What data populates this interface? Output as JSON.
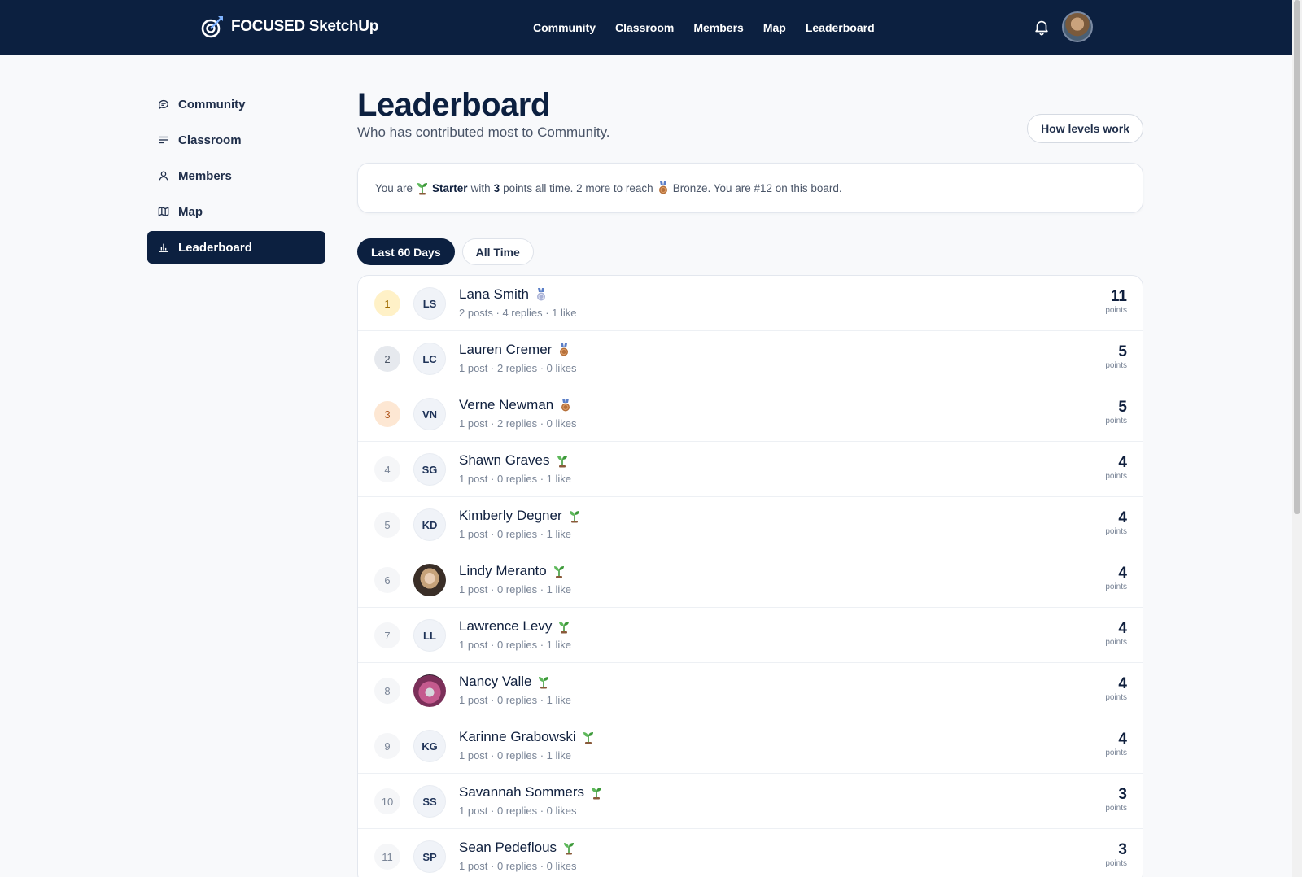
{
  "brand": {
    "name": "FOCUSED SketchUp",
    "icon": "target-arrow-logo-icon"
  },
  "topnav": [
    "Community",
    "Classroom",
    "Members",
    "Map",
    "Leaderboard"
  ],
  "sidebar": {
    "items": [
      {
        "label": "Community",
        "icon": "chat-bubble-icon",
        "active": false
      },
      {
        "label": "Classroom",
        "icon": "lines-icon",
        "active": false
      },
      {
        "label": "Members",
        "icon": "person-icon",
        "active": false
      },
      {
        "label": "Map",
        "icon": "map-icon",
        "active": false
      },
      {
        "label": "Leaderboard",
        "icon": "bar-chart-icon",
        "active": true
      }
    ]
  },
  "page": {
    "title": "Leaderboard",
    "subtitle": "Who has contributed most to Community.",
    "levels_button": "How levels work"
  },
  "status": {
    "you_are": "You are",
    "level": "Starter",
    "with": "with",
    "points": "3",
    "rest": "points all time. 2 more to reach",
    "next_level": "Bronze. You are #12 on this board."
  },
  "tabs": [
    {
      "label": "Last 60 Days",
      "active": true
    },
    {
      "label": "All Time",
      "active": false
    }
  ],
  "leaderboard": [
    {
      "rank": "1",
      "initials": "LS",
      "name": "Lana Smith",
      "badge": "silver",
      "meta": "2 posts · 4 replies · 1 like",
      "points": "11",
      "points_label": "points"
    },
    {
      "rank": "2",
      "initials": "LC",
      "name": "Lauren Cremer",
      "badge": "bronze",
      "meta": "1 post · 2 replies · 0 likes",
      "points": "5",
      "points_label": "points"
    },
    {
      "rank": "3",
      "initials": "VN",
      "name": "Verne Newman",
      "badge": "bronze",
      "meta": "1 post · 2 replies · 0 likes",
      "points": "5",
      "points_label": "points"
    },
    {
      "rank": "4",
      "initials": "SG",
      "name": "Shawn Graves",
      "badge": "starter",
      "meta": "1 post · 0 replies · 1 like",
      "points": "4",
      "points_label": "points"
    },
    {
      "rank": "5",
      "initials": "KD",
      "name": "Kimberly Degner",
      "badge": "starter",
      "meta": "1 post · 0 replies · 1 like",
      "points": "4",
      "points_label": "points"
    },
    {
      "rank": "6",
      "initials": "",
      "photo": "lindy",
      "name": "Lindy Meranto",
      "badge": "starter",
      "meta": "1 post · 0 replies · 1 like",
      "points": "4",
      "points_label": "points"
    },
    {
      "rank": "7",
      "initials": "LL",
      "name": "Lawrence Levy",
      "badge": "starter",
      "meta": "1 post · 0 replies · 1 like",
      "points": "4",
      "points_label": "points"
    },
    {
      "rank": "8",
      "initials": "",
      "photo": "nancy",
      "name": "Nancy Valle",
      "badge": "starter",
      "meta": "1 post · 0 replies · 1 like",
      "points": "4",
      "points_label": "points"
    },
    {
      "rank": "9",
      "initials": "KG",
      "name": "Karinne Grabowski",
      "badge": "starter",
      "meta": "1 post · 0 replies · 1 like",
      "points": "4",
      "points_label": "points"
    },
    {
      "rank": "10",
      "initials": "SS",
      "name": "Savannah Sommers",
      "badge": "starter",
      "meta": "1 post · 0 replies · 0 likes",
      "points": "3",
      "points_label": "points"
    },
    {
      "rank": "11",
      "initials": "SP",
      "name": "Sean Pedeflous",
      "badge": "starter",
      "meta": "1 post · 0 replies · 0 likes",
      "points": "3",
      "points_label": "points"
    }
  ],
  "colors": {
    "navy": "#0c2040",
    "silver": "#9aa3c9",
    "bronze": "#b5703a",
    "starter": "#3d9a3a"
  }
}
